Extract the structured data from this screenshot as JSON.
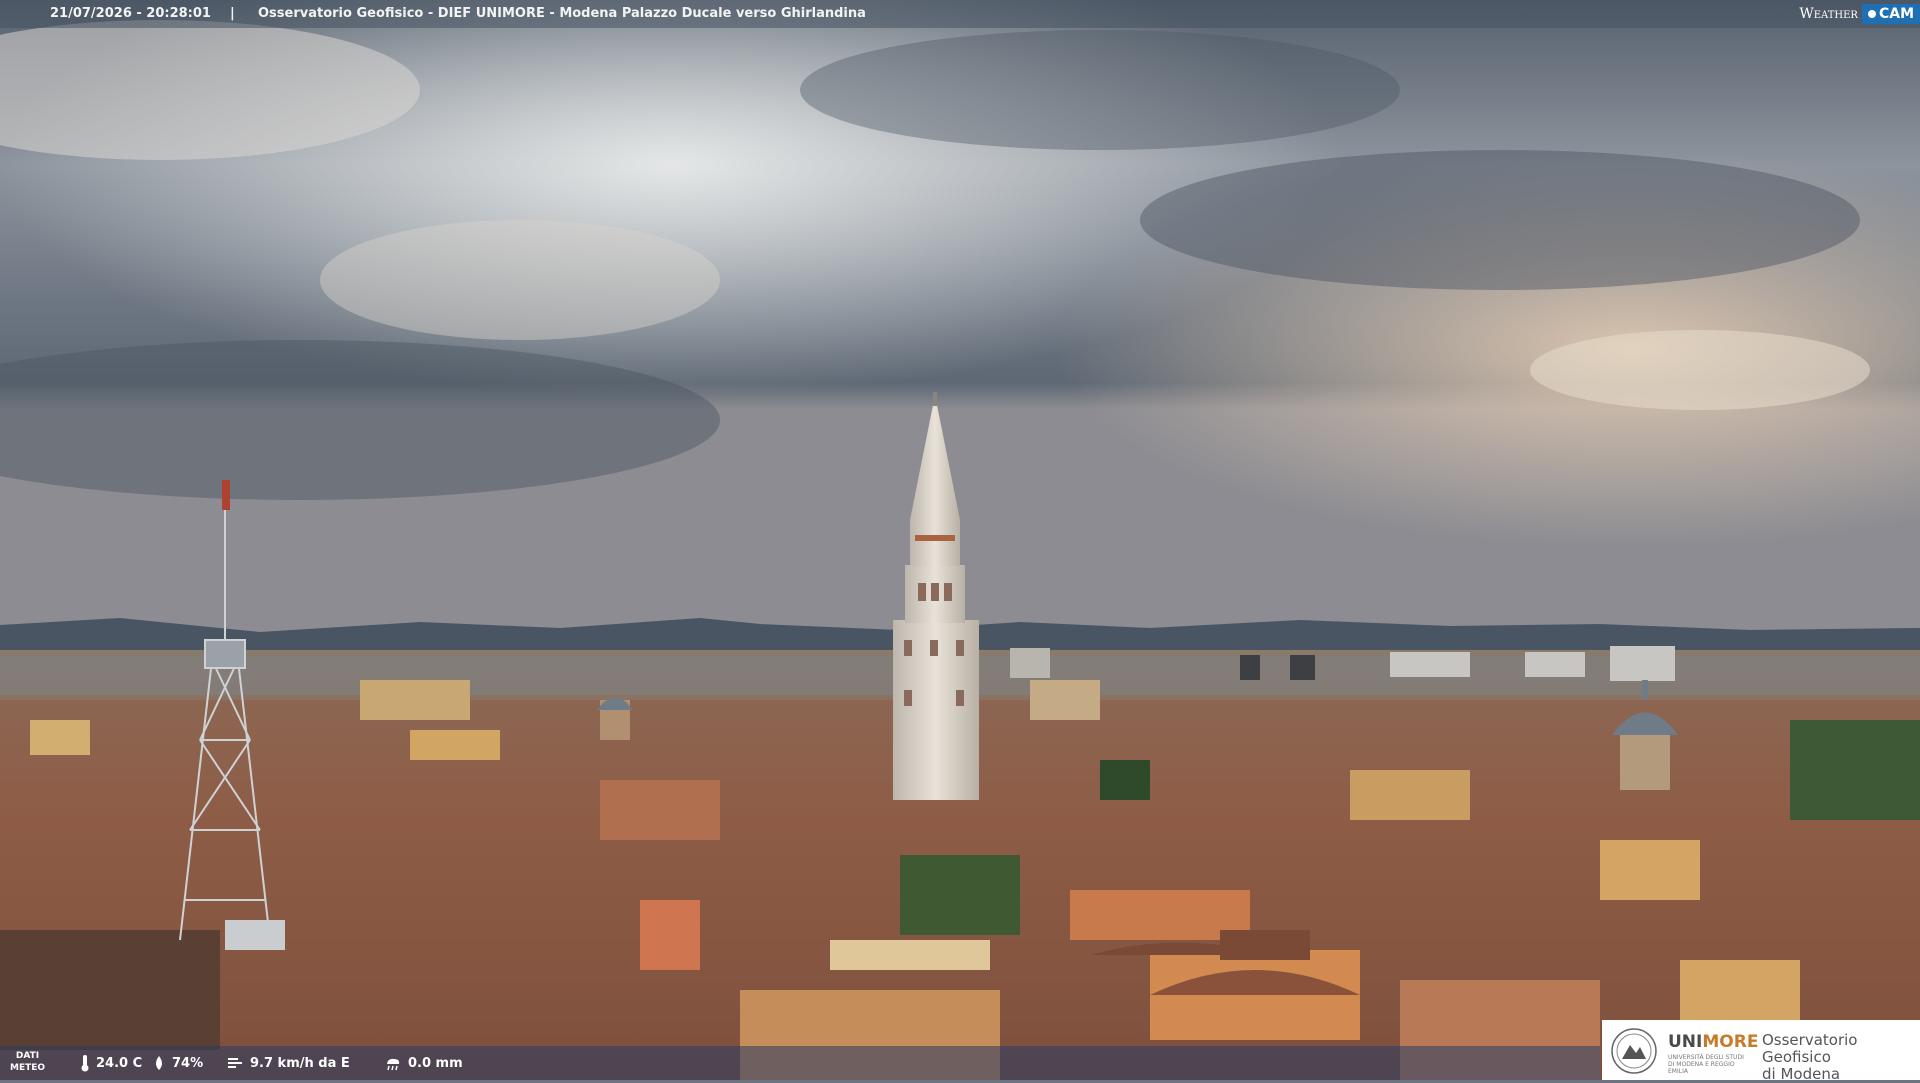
{
  "header": {
    "timestamp": "21/07/2026 - 20:28:01",
    "separator": "|",
    "title": "Osservatorio Geofisico - DIEF UNIMORE - Modena Palazzo Ducale verso Ghirlandina"
  },
  "brand": {
    "weather": "Weather",
    "cam": "CAM"
  },
  "meteo": {
    "label_line1": "DATI",
    "label_line2": "METEO",
    "temperature": "24.0 C",
    "humidity": "74%",
    "wind": "9.7 km/h da E",
    "rain": "0.0 mm"
  },
  "logo": {
    "uni": "UNI",
    "more": "MORE",
    "uni_subtitle": "UNIVERSITÀ DEGLI STUDI DI MODENA E REGGIO EMILIA",
    "observatory_line1": "Osservatorio Geofisico",
    "observatory_line2": "di Modena"
  },
  "colors": {
    "sky_top": "#5f6874",
    "sky_mid": "#8c939c",
    "sky_warm": "#e9d2b8",
    "roof": "#8a5a44",
    "wall": "#c9a06e",
    "bar": "#465260"
  },
  "icons": [
    "thermometer-icon",
    "humidity-drop-icon",
    "wind-icon",
    "rain-icon",
    "university-seal-icon"
  ]
}
